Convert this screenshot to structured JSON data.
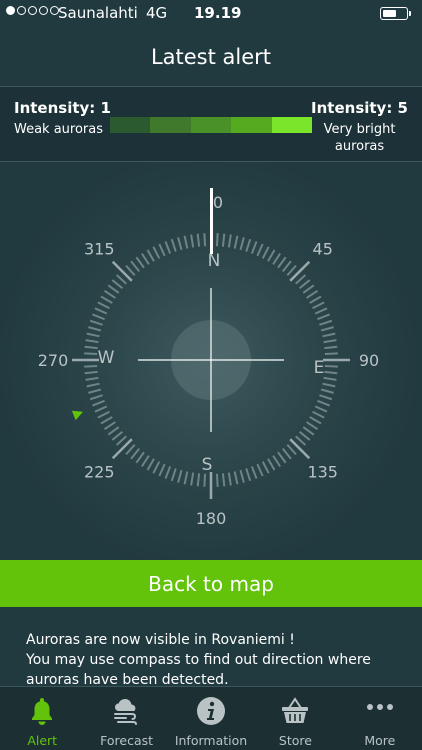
{
  "status": {
    "carrier": "Saunalahti",
    "network": "4G",
    "time": "19.19",
    "battery_level": 0.6,
    "signal_bars": 1
  },
  "header": {
    "title": "Latest alert"
  },
  "intensity": {
    "low_title": "Intensity: 1",
    "low_desc": "Weak auroras",
    "high_title": "Intensity: 5",
    "high_desc_line1": "Very bright",
    "high_desc_line2": "auroras",
    "scale_colors": [
      "#2a5a2e",
      "#3f7a2c",
      "#4a9228",
      "#56aa1f",
      "#7ae52a"
    ]
  },
  "compass": {
    "degree_labels": [
      "0",
      "45",
      "90",
      "135",
      "180",
      "225",
      "270",
      "315"
    ],
    "cardinals": {
      "north": "N",
      "east": "E",
      "south": "S",
      "west": "W"
    },
    "aurora_direction_deg": 248,
    "needle_deg": 0
  },
  "back_button": {
    "label": "Back to map"
  },
  "message": {
    "line1": "Auroras are now visible in Rovaniemi !",
    "line2": "You may use compass to find out direction where auroras have been detected."
  },
  "tabs": [
    {
      "label": "Alert",
      "icon": "bell-icon",
      "active": true
    },
    {
      "label": "Forecast",
      "icon": "cloud-wind-icon",
      "active": false
    },
    {
      "label": "Information",
      "icon": "info-icon",
      "active": false
    },
    {
      "label": "Store",
      "icon": "basket-icon",
      "active": false
    },
    {
      "label": "More",
      "icon": "more-dots-icon",
      "active": false
    }
  ],
  "colors": {
    "background": "#213a40",
    "accent": "#62c30a",
    "tab_inactive": "#b9c3c5"
  }
}
